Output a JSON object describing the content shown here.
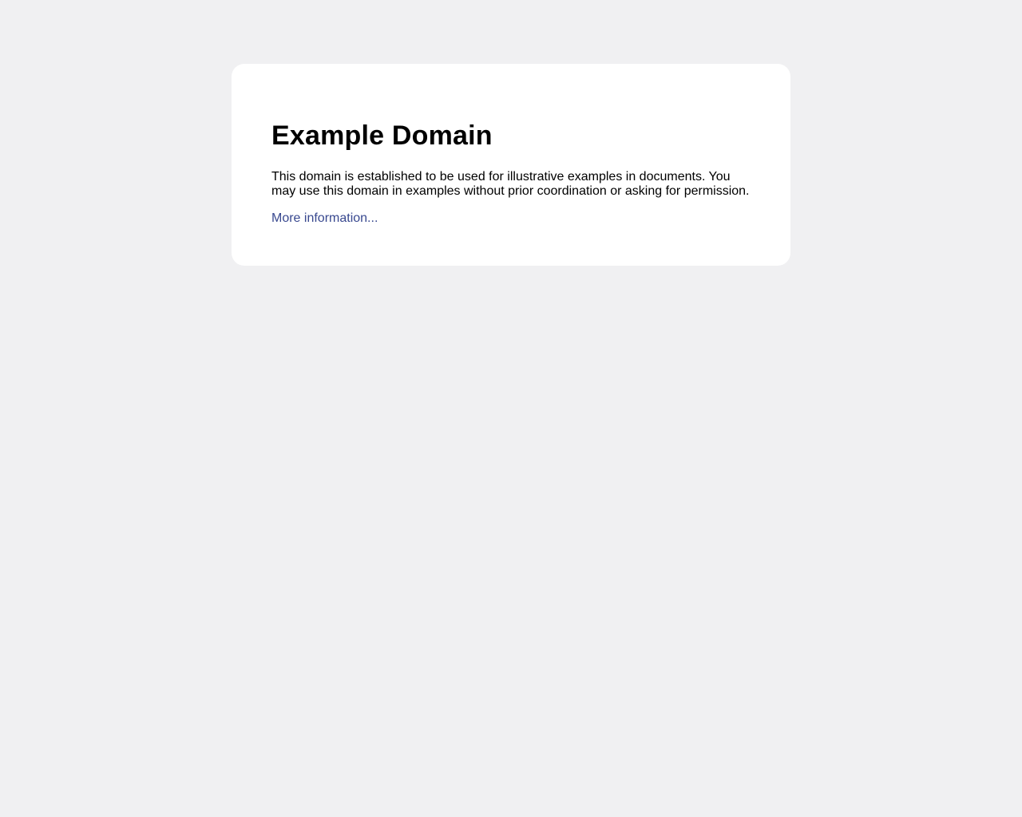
{
  "page": {
    "background_color": "#f0f0f2",
    "card_color": "#ffffff",
    "link_color": "#38488f"
  },
  "content": {
    "title": "Example Domain",
    "description": "This domain is established to be used for illustrative examples in documents. You may use this domain in examples without prior coordination or asking for permission.",
    "link_text": "More information..."
  }
}
